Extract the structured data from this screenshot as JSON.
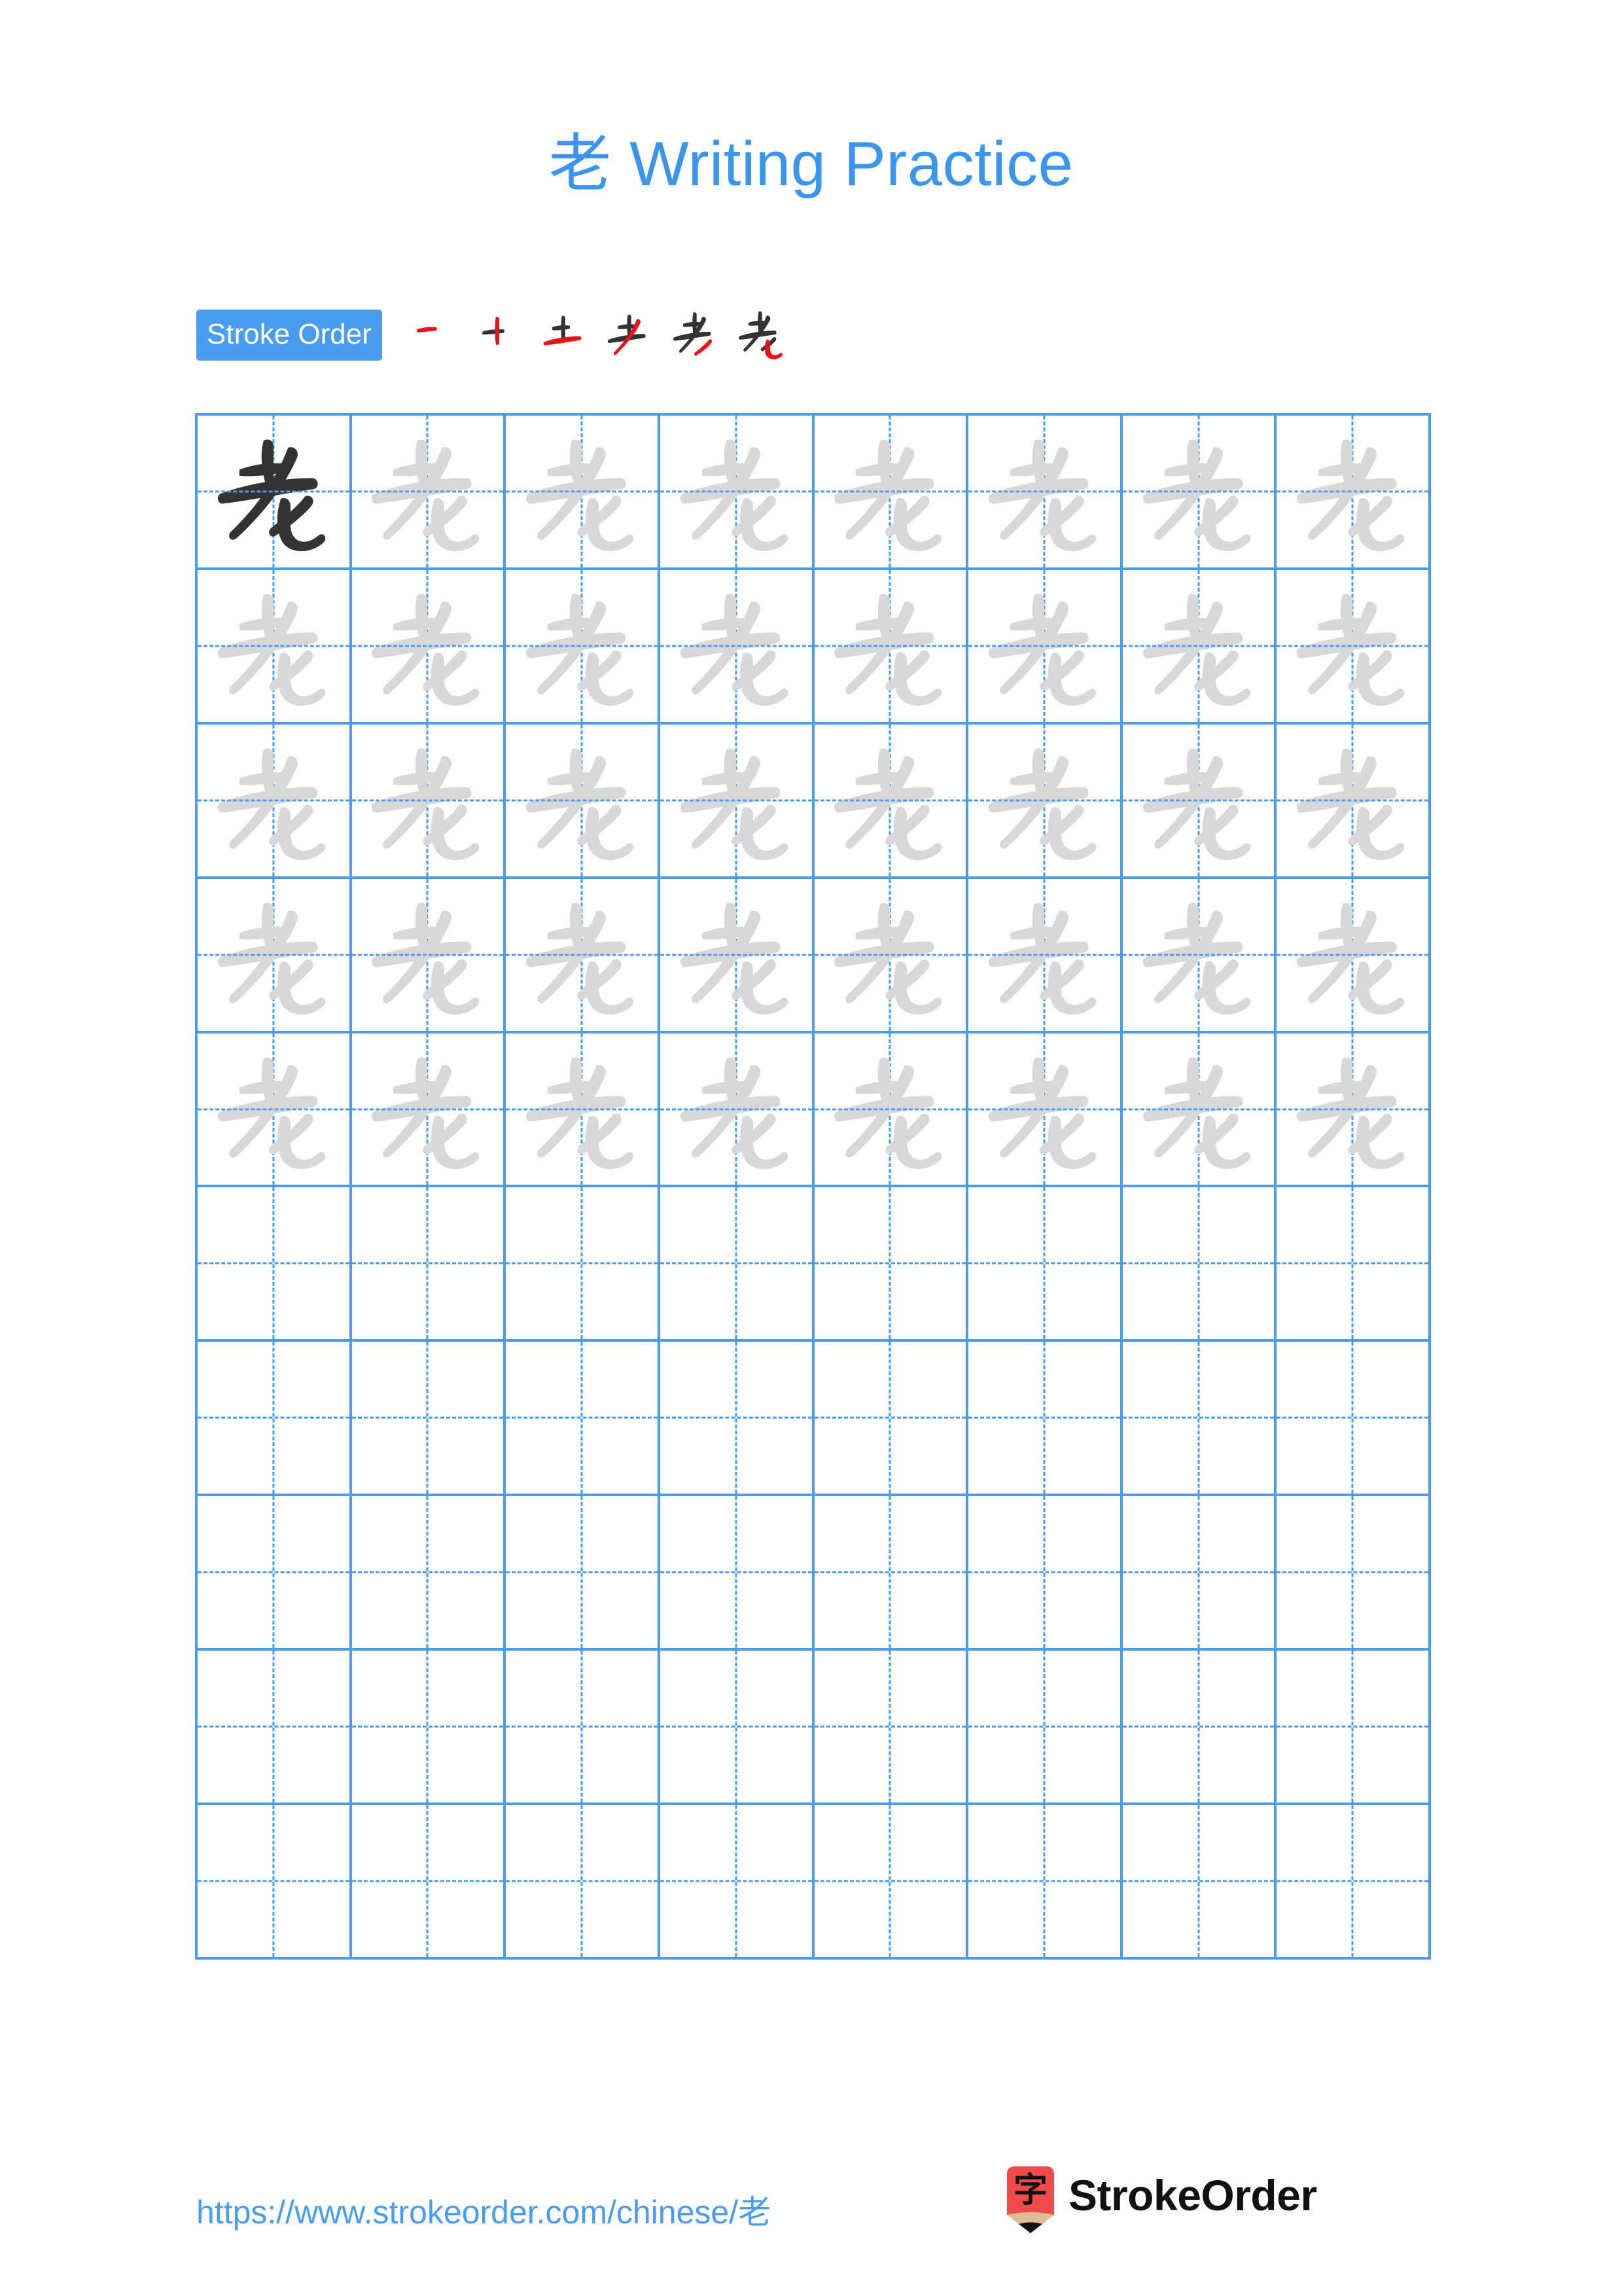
{
  "page": {
    "title": "老 Writing Practice",
    "character": "老",
    "background_color": "#ffffff",
    "accent_color": "#4a9cf0",
    "ink_color": "#333333",
    "trace_color": "#d8d8d8",
    "highlight_stroke_color": "#e8131a"
  },
  "stroke_order": {
    "badge_label": "Stroke Order",
    "total_strokes": 6,
    "steps": [
      {
        "index": 1,
        "glyph": "一",
        "new_stroke": "heng"
      },
      {
        "index": 2,
        "glyph": "十",
        "new_stroke": "shu"
      },
      {
        "index": 3,
        "glyph": "土",
        "new_stroke": "heng"
      },
      {
        "index": 4,
        "glyph": "耂",
        "new_stroke": "pie"
      },
      {
        "index": 5,
        "glyph": "老",
        "new_stroke": "pie"
      },
      {
        "index": 6,
        "glyph": "老",
        "new_stroke": "shuwangou"
      }
    ]
  },
  "practice_grid": {
    "columns": 8,
    "rows": 10,
    "character": "老",
    "filled_rows": 5,
    "cells": [
      [
        "dark",
        "light",
        "light",
        "light",
        "light",
        "light",
        "light",
        "light"
      ],
      [
        "light",
        "light",
        "light",
        "light",
        "light",
        "light",
        "light",
        "light"
      ],
      [
        "light",
        "light",
        "light",
        "light",
        "light",
        "light",
        "light",
        "light"
      ],
      [
        "light",
        "light",
        "light",
        "light",
        "light",
        "light",
        "light",
        "light"
      ],
      [
        "light",
        "light",
        "light",
        "light",
        "light",
        "light",
        "light",
        "light"
      ],
      [
        "empty",
        "empty",
        "empty",
        "empty",
        "empty",
        "empty",
        "empty",
        "empty"
      ],
      [
        "empty",
        "empty",
        "empty",
        "empty",
        "empty",
        "empty",
        "empty",
        "empty"
      ],
      [
        "empty",
        "empty",
        "empty",
        "empty",
        "empty",
        "empty",
        "empty",
        "empty"
      ],
      [
        "empty",
        "empty",
        "empty",
        "empty",
        "empty",
        "empty",
        "empty",
        "empty"
      ],
      [
        "empty",
        "empty",
        "empty",
        "empty",
        "empty",
        "empty",
        "empty",
        "empty"
      ]
    ]
  },
  "footer": {
    "url": "https://www.strokeorder.com/chinese/老",
    "brand_name": "StrokeOrder",
    "logo_character": "字",
    "logo_body_color": "#ef4b4b",
    "logo_wood_color": "#debe94",
    "logo_tip_color": "#111111"
  }
}
